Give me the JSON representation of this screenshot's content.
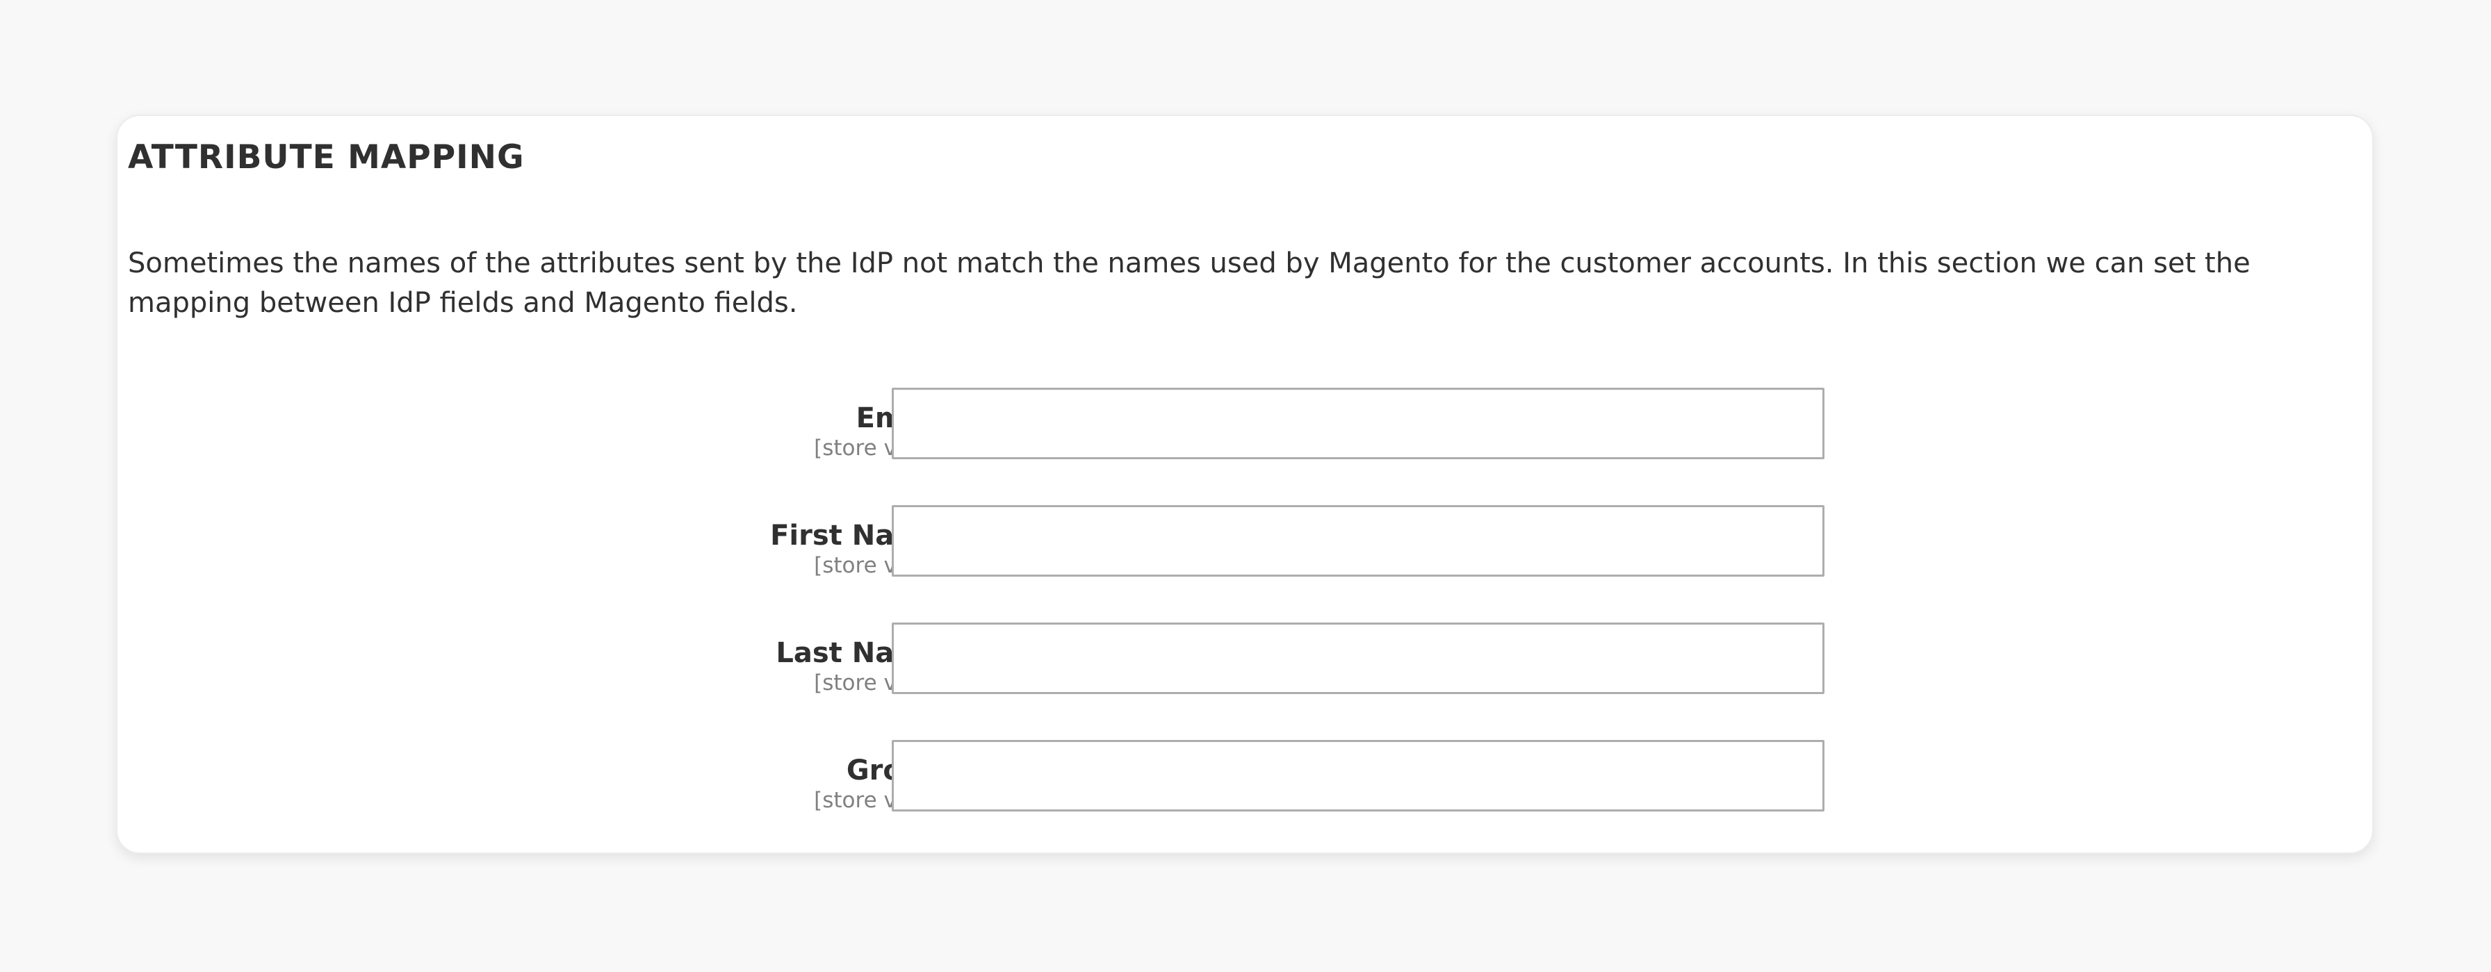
{
  "section": {
    "title": "ATTRIBUTE MAPPING",
    "description": "Sometimes the names of the attributes sent by the IdP not match the names used by Magento for the customer accounts. In this section we can set the mapping between IdP fields and Magento fields."
  },
  "fields": [
    {
      "label": "Email",
      "scope": "[store view]",
      "value": ""
    },
    {
      "label": "First Name",
      "scope": "[store view]",
      "value": ""
    },
    {
      "label": "Last Name",
      "scope": "[store view]",
      "value": ""
    },
    {
      "label": "Group",
      "scope": "[store view]",
      "value": ""
    }
  ],
  "colors": {
    "background": "#f8f8f8",
    "card": "#ffffff",
    "text": "#303030",
    "muted": "#808080",
    "input_border": "#adadad"
  }
}
